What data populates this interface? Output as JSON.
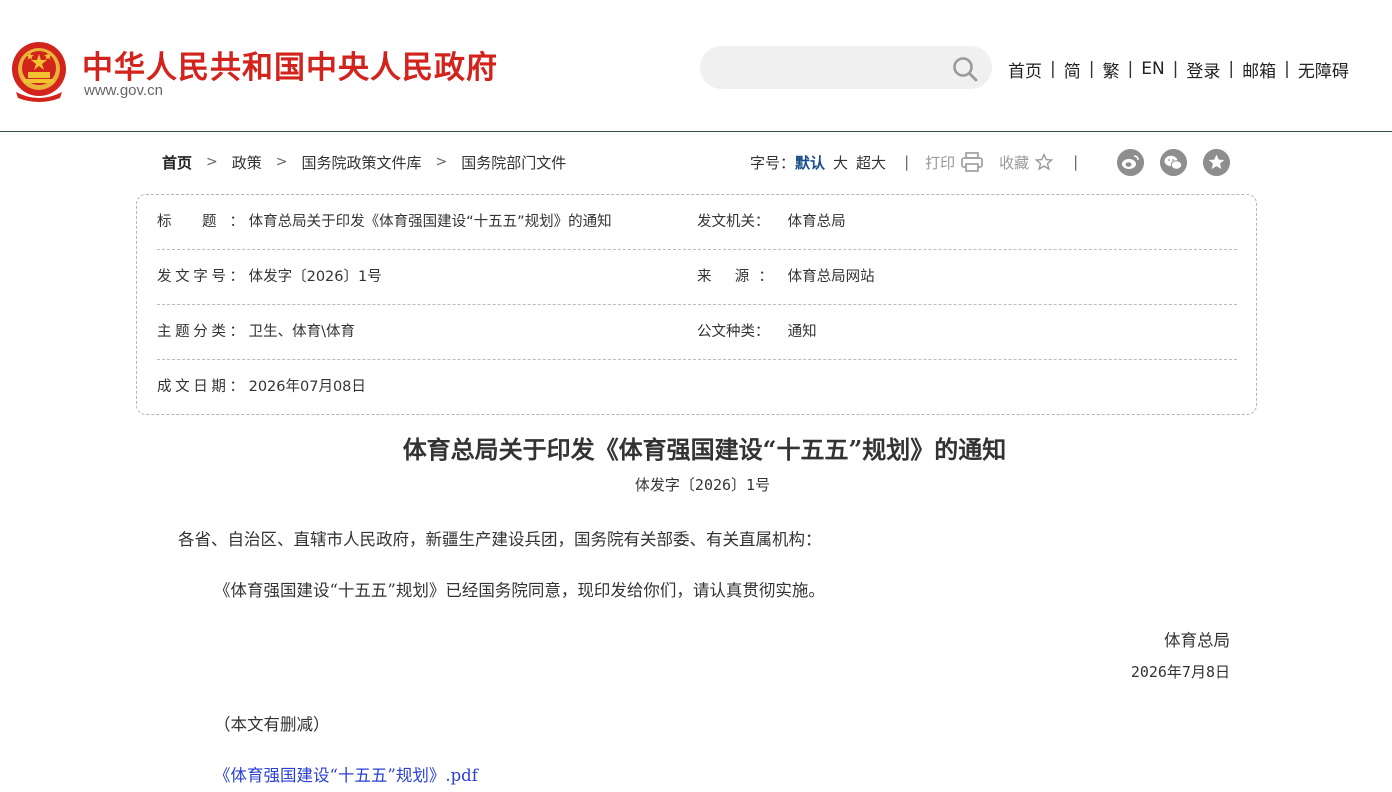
{
  "header": {
    "site_name": "中华人民共和国中央人民政府",
    "site_url": "www.gov.cn",
    "search_placeholder": "",
    "nav": [
      "首页",
      "简",
      "繁",
      "EN",
      "登录",
      "邮箱",
      "无障碍"
    ],
    "brand_color": "#d2231d"
  },
  "breadcrumb": [
    "首页",
    "政策",
    "国务院政策文件库",
    "国务院部门文件"
  ],
  "tools": {
    "font_size_label": "字号：",
    "font_sizes": [
      "默认",
      "大",
      "超大"
    ],
    "print_label": "打印",
    "favorite_label": "收藏",
    "share_icons": [
      "weibo-icon",
      "wechat-icon",
      "favorite-share-icon"
    ]
  },
  "info": {
    "title_label": "标 题：",
    "title_value": "体育总局关于印发《体育强国建设“十五五”规划》的通知",
    "issuer_label": "发文机关：",
    "issuer_value": "体育总局",
    "docno_label": "发文字号：",
    "docno_value": "体发字〔2026〕1号",
    "source_label": "来 源：",
    "source_value": "体育总局网站",
    "topic_label": "主题分类：",
    "topic_value": "卫生、体育\\体育",
    "type_label": "公文种类：",
    "type_value": "通知",
    "date_label": "成文日期：",
    "date_value": "2026年07月08日"
  },
  "document": {
    "title": "体育总局关于印发《体育强国建设“十五五”规划》的通知",
    "number": "体发字〔2026〕1号",
    "salutation": "各省、自治区、直辖市人民政府，新疆生产建设兵团，国务院有关部委、有关直属机构：",
    "body": "《体育强国建设“十五五”规划》已经国务院同意，现印发给你们，请认真贯彻实施。",
    "signer": "体育总局",
    "sign_date": "2026年7月8日",
    "note": "（本文有删减）",
    "attachment": "《体育强国建设“十五五”规划》.pdf"
  }
}
